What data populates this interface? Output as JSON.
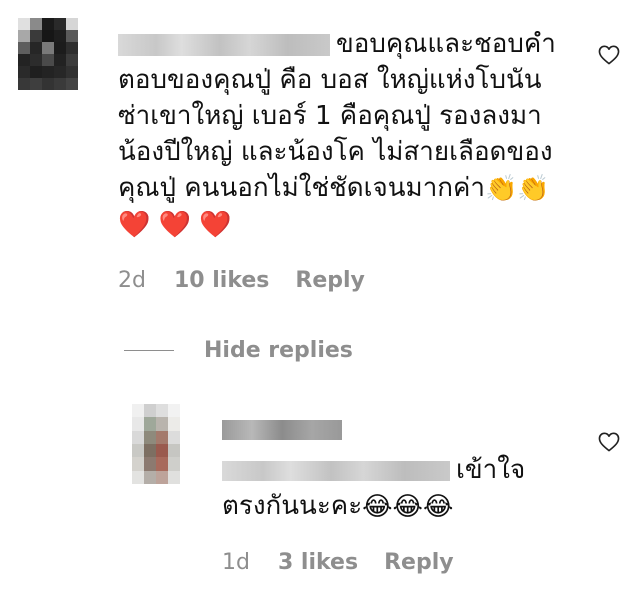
{
  "comment": {
    "text_line1": "ขอบคุณและชอบคำ",
    "text_lines": [
      "ตอบของคุณปู่ คือ บอส ใหญ่แห่งโบนัน",
      "ซ่าเขาใหญ่ เบอร์ 1 คือคุณปู่ รองลงมา",
      "น้องปีใหญ่ และน้องโค ไม่สายเลือดของ",
      "คุณปู่ คนนอกไม่ใช่ชัดเจนมากค่า"
    ],
    "clap_emoji": "👏",
    "heart_emoji": "❤️",
    "time": "2d",
    "likes": "10 likes",
    "reply": "Reply"
  },
  "hide_replies": "Hide replies",
  "reply_comment": {
    "text_line1": "เข้าใจ",
    "text_line2": "ตรงกันนะคะ",
    "laugh_emoji": "😂",
    "time": "1d",
    "likes": "3 likes",
    "reply": "Reply"
  },
  "icons": {
    "like": "heart-outline-icon"
  }
}
